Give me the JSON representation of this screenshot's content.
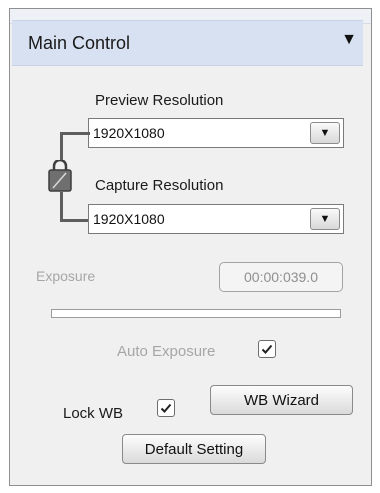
{
  "panel": {
    "title": "Main Control",
    "collapse_icon": "triangle-down-icon"
  },
  "preview": {
    "label": "Preview Resolution",
    "value": "1920X1080"
  },
  "capture": {
    "label": "Capture Resolution",
    "value": "1920X1080"
  },
  "exposure": {
    "label": "Exposure",
    "time": "00:00:039.0",
    "auto_label": "Auto Exposure",
    "auto_checked": true
  },
  "wb": {
    "lock_label": "Lock WB",
    "lock_checked": true,
    "wizard_label": "WB Wizard"
  },
  "default_button": "Default Setting",
  "icons": {
    "lock": "padlock-icon",
    "dropdown": "dropdown-arrow-icon",
    "check": "checkmark-icon"
  },
  "colors": {
    "header_bg": "#d8e1f1",
    "panel_bg": "#f0f0f0",
    "disabled_text": "#a6a6a6"
  }
}
